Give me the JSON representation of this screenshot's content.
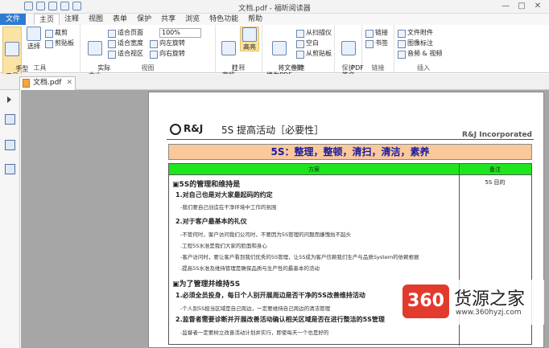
{
  "window": {
    "title": "文档.pdf - 福昕阅读器",
    "controls": [
      "—",
      "□",
      "✕"
    ]
  },
  "menu": {
    "file": "文件",
    "tabs": [
      "主页",
      "注释",
      "视图",
      "表单",
      "保护",
      "共享",
      "浏览",
      "特色功能",
      "帮助"
    ]
  },
  "ribbon": {
    "tools": {
      "hand": "手型\n工具",
      "select": "选择",
      "crop": "裁剪",
      "clipboard": "剪贴板",
      "label": "工具"
    },
    "view": {
      "actual": "实际\n大小",
      "fit_page": "适合页面",
      "fit_width": "适合宽度",
      "fit_view": "适合视区",
      "zoom": "100%",
      "rot_left": "向左旋转",
      "rot_right": "向右旋转",
      "label": "视图"
    },
    "annot": {
      "typewriter": "打\n字机",
      "highlight": "高亮",
      "label": "注释"
    },
    "create": {
      "convert": "将文件转\n换为PDF",
      "scanner": "从扫描仪",
      "blank": "空白",
      "from_clip": "从剪贴板",
      "label": "创建"
    },
    "protect": {
      "sign": "PDF\n签名",
      "label": "保护"
    },
    "links": {
      "link": "链接",
      "bookmark": "书签",
      "label": "链接"
    },
    "insert": {
      "attach": "文件附件",
      "image": "图像标注",
      "av": "音频 & 视频",
      "label": "插入"
    }
  },
  "doc_tab": {
    "name": "文档.pdf"
  },
  "document": {
    "logo": "R&J",
    "title": "5S 提高活动［必要性］",
    "corp": "R&J Incorporated",
    "banner": "5S：整理，整顿，清扫，清洁，素养",
    "col_plan": "方案",
    "col_note": "备注",
    "note": "5S 目的",
    "s1": "▣5S的管理和维持是",
    "s1_1": "1.对自己也是对大家最起码的约定",
    "s1_1a": "-我们要自己创造在干净环境中工作的氛围",
    "s1_2": "2.对于客户最基本的礼仪",
    "s1_2a": "-不管何时，客户访问我们公司时，不要因为5S管理的问题而嫌愧抬不起头",
    "s1_2b": ".工程5S水准是我们大家的脸面和身心",
    "s1_2c": "-客户访问时，要让客户看到我们优秀的5S管理，让5S成为客户信赖我们生产与品质System的依赖根据",
    "s1_2d": ".提高5S水准及维持管理是确保品质与生产性的最基本的活动",
    "s2": "▣为了管理并维持5S",
    "s2_1": "1.必须全员投身，每日个人别开展周边是否干净的5S改善维持活动",
    "s2_1a": "-个人别5S担当区域是自己周边，一定要维持自己周边的清洁管理",
    "s2_2": "2.监督者需要诊断并开展改善活动确认相关区域是否在进行整洁的5S管理",
    "s2_2a": "-监督者一定要树立改善活动计划并实行，即使每天一个也是好的"
  },
  "watermark": {
    "logo": "360",
    "name": "货源之家",
    "url": "www.360hyzj.com"
  }
}
